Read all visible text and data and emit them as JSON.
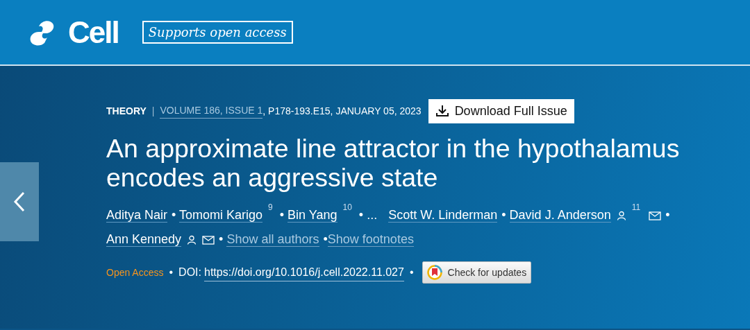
{
  "header": {
    "logo": "Cell",
    "badge": "Supports open access"
  },
  "article": {
    "type": "THEORY",
    "separator": "|",
    "volume_link": "VOLUME 186, ISSUE 1",
    "citation": ", P178-193.E15, JANUARY 05, 2023",
    "download_button": "Download Full Issue",
    "title": "An approximate line attractor in the hypothalamus encodes an aggressive state",
    "bullet": "•",
    "authors": [
      {
        "kind": "author",
        "name": "Aditya Nair",
        "profile": false,
        "email": false
      },
      {
        "kind": "author",
        "name": "Tomomi Karigo",
        "sup": "9",
        "profile": false,
        "email": false
      },
      {
        "kind": "author",
        "name": "Bin Yang",
        "sup": "10",
        "profile": false,
        "email": false
      },
      {
        "kind": "ellipsis",
        "name": "..."
      },
      {
        "kind": "author",
        "name": "Scott W. Linderman",
        "profile": false,
        "email": false
      },
      {
        "kind": "author",
        "name": "David J. Anderson",
        "sup": "11",
        "profile": true,
        "email": true
      },
      {
        "kind": "author",
        "name": "Ann Kennedy",
        "profile": true,
        "email": true
      }
    ],
    "show_all": "Show all authors",
    "show_footnotes": "Show footnotes",
    "open_access": "Open Access",
    "doi_label": "DOI:",
    "doi": "https://doi.org/10.1016/j.cell.2022.11.027",
    "check_updates": "Check for updates"
  }
}
